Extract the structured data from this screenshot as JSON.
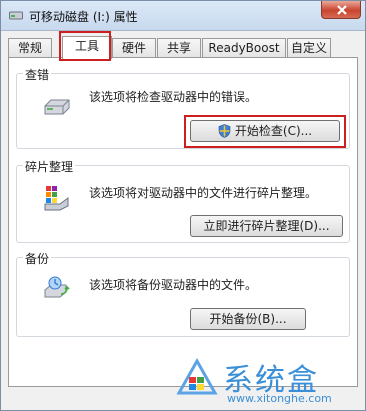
{
  "window": {
    "title": "可移动磁盘 (I:) 属性",
    "close_icon": "close-icon"
  },
  "tabs": [
    {
      "label": "常规",
      "active": false
    },
    {
      "label": "工具",
      "active": true
    },
    {
      "label": "硬件",
      "active": false
    },
    {
      "label": "共享",
      "active": false
    },
    {
      "label": "ReadyBoost",
      "active": false
    },
    {
      "label": "自定义",
      "active": false
    }
  ],
  "groups": {
    "error_check": {
      "legend": "查错",
      "icon": "drive-icon",
      "description": "该选项将检查驱动器中的错误。",
      "button": "开始检查(C)..."
    },
    "defrag": {
      "legend": "碎片整理",
      "icon": "defrag-icon",
      "description": "该选项将对驱动器中的文件进行碎片整理。",
      "button": "立即进行碎片整理(D)..."
    },
    "backup": {
      "legend": "备份",
      "icon": "backup-icon",
      "description": "该选项将备份驱动器中的文件。",
      "button": "开始备份(B)..."
    }
  },
  "watermark": {
    "text": "系统盒",
    "url": "www.xitonghe.com"
  },
  "colors": {
    "highlight": "#cc1f1f",
    "watermark": "#3a8fd8"
  }
}
